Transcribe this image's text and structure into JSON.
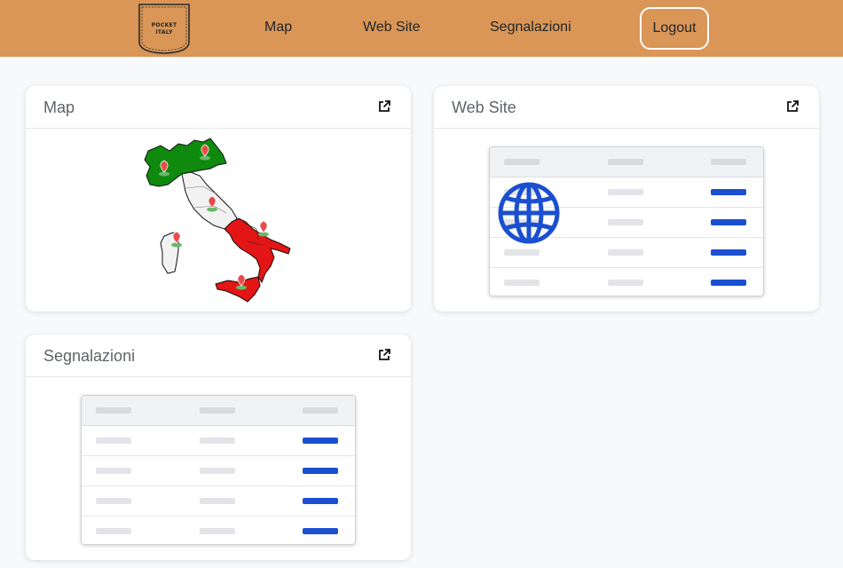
{
  "header": {
    "logo": {
      "icon": "pocket-icon",
      "line1": "POCKET",
      "line2": "ITALY"
    },
    "nav": {
      "map": "Map",
      "website": "Web Site",
      "reports": "Segnalazioni"
    },
    "logout": "Logout"
  },
  "cards": {
    "map": {
      "title": "Map",
      "icon": "external-link-icon"
    },
    "website": {
      "title": "Web Site",
      "icon": "external-link-icon"
    },
    "reports": {
      "title": "Segnalazioni",
      "icon": "external-link-icon"
    }
  },
  "colors": {
    "header": "#d99657",
    "accent": "#1a4fd0",
    "map_green": "#0f8a0f",
    "map_red": "#e31515",
    "map_white": "#f2f2f2"
  }
}
